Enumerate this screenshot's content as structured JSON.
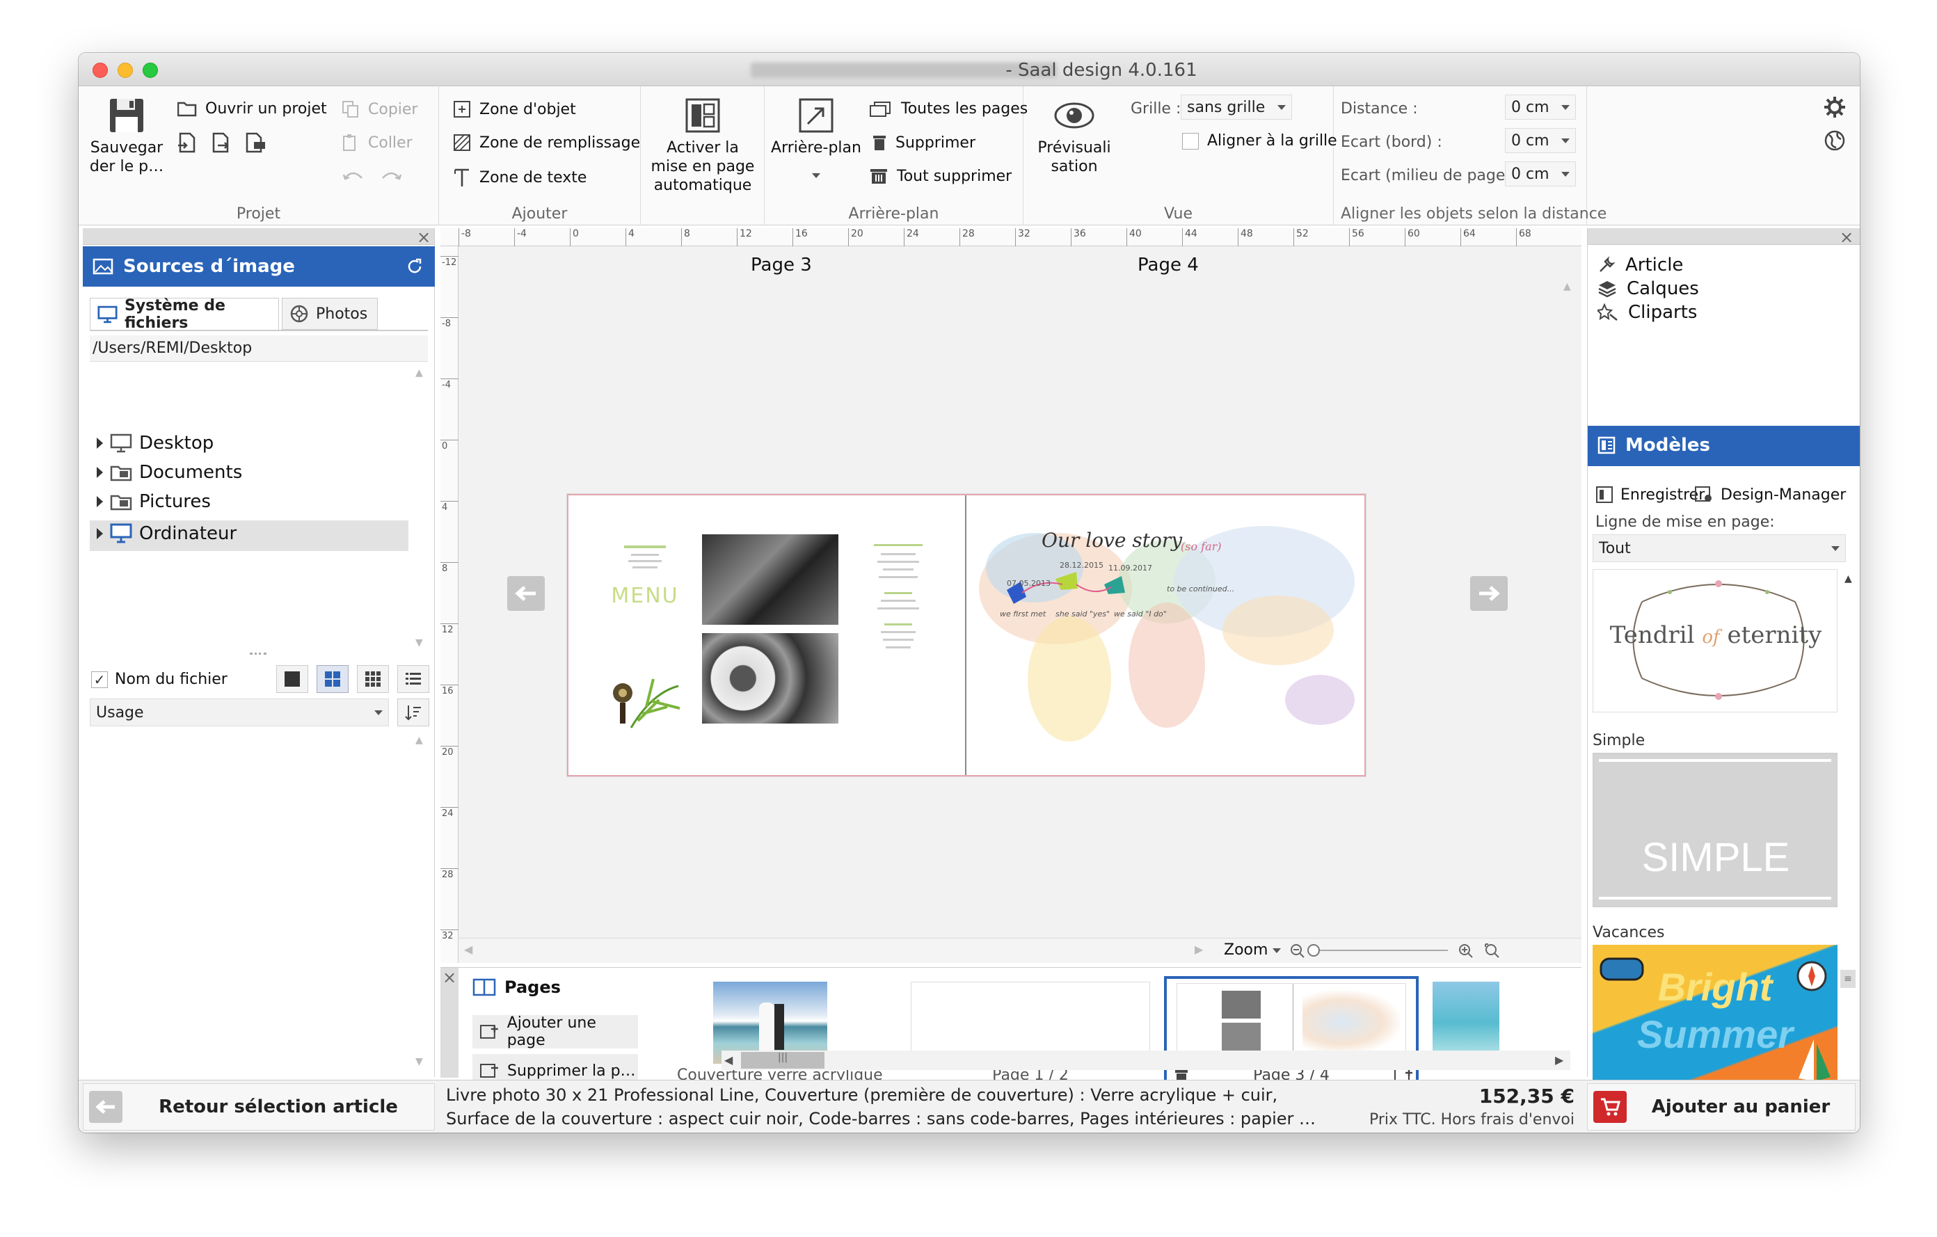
{
  "window": {
    "title": "- Saal design 4.0.161"
  },
  "ribbon": {
    "projet": {
      "label": "Projet",
      "save": "Sauvegar der le p…",
      "open": "Ouvrir un projet",
      "copy": "Copier",
      "paste": "Coller"
    },
    "ajouter": {
      "label": "Ajouter",
      "object_zone": "Zone d'objet",
      "fill_zone": "Zone de remplissage",
      "text_zone": "Zone de texte"
    },
    "auto_layout": "Activer la mise en page automatique",
    "arriere": {
      "label": "Arrière-plan",
      "button": "Arrière-plan",
      "all_pages": "Toutes les pages",
      "delete": "Supprimer",
      "delete_all": "Tout supprimer"
    },
    "vue": {
      "label": "Vue",
      "preview": "Prévisuali sation",
      "grid_label": "Grille :",
      "grid_value": "sans grille",
      "align_grid": "Aligner à la grille"
    },
    "align": {
      "label": "Aligner les objets selon la distance",
      "distance": "Distance :",
      "edge": "Ecart (bord) :",
      "middle": "Ecart (milieu de page) :",
      "v1": "0 cm",
      "v2": "0 cm",
      "v3": "0 cm"
    }
  },
  "left_panel": {
    "title": "Sources d´image",
    "tab_fs": "Système de fichiers",
    "tab_photos": "Photos",
    "path": "/Users/REMI/Desktop",
    "tree": [
      "Desktop",
      "Documents",
      "Pictures"
    ],
    "computer": "Ordinateur",
    "filename_label": "Nom du fichier",
    "sort_value": "Usage"
  },
  "canvas": {
    "page_left": "Page 3",
    "page_right": "Page 4",
    "ruler_h": [
      "-8",
      "-4",
      "0",
      "4",
      "8",
      "12",
      "16",
      "20",
      "24",
      "28",
      "32",
      "36",
      "40",
      "44",
      "48",
      "52",
      "56",
      "60",
      "64",
      "68"
    ],
    "ruler_v": [
      "-12",
      "-8",
      "-4",
      "0",
      "4",
      "8",
      "12",
      "16",
      "20",
      "24",
      "28",
      "32"
    ],
    "zoom": "Zoom",
    "menu_text": "MENU",
    "map_title": "Our love story",
    "map_sub": "(so far)",
    "map_dates": [
      "07.05.2013",
      "28.12.2015",
      "11.09.2017"
    ],
    "map_captions": [
      "we first met",
      "she said \"yes\"",
      "we said \"I do\"",
      "to be continued..."
    ]
  },
  "pages_panel": {
    "title": "Pages",
    "add": "Ajouter une page",
    "remove": "Supprimer la p…",
    "thumbs": [
      "Couverture verre acrylique",
      "Page 1 / 2",
      "Page 3 / 4"
    ]
  },
  "right_panel": {
    "items": [
      "Article",
      "Calques",
      "Cliparts",
      "Modèles"
    ],
    "save": "Enregistrer",
    "design_manager": "Design-Manager",
    "layout_line": "Ligne de mise en page:",
    "layout_value": "Tout",
    "tendril": {
      "part1": "Tendril",
      "part2": "of",
      "part3": "eternity"
    },
    "simple_label": "Simple",
    "simple_text": "SIMPLE",
    "vacances_label": "Vacances",
    "summer_1": "Bright",
    "summer_2": "Summer"
  },
  "footer": {
    "back": "Retour sélection article",
    "line1": "Livre photo 30 x 21 Professional Line, Couverture (première de couverture) : Verre acrylique + cuir,",
    "line2": "Surface de la couverture : aspect cuir noir, Code-barres : sans code-barres, Pages intérieures : papier …",
    "price": "152,35 €",
    "price_note": "Prix TTC. Hors frais d'envoi",
    "cart": "Ajouter au panier"
  },
  "colors": {
    "accent": "#2a64b8",
    "cart_red": "#d0282b"
  }
}
